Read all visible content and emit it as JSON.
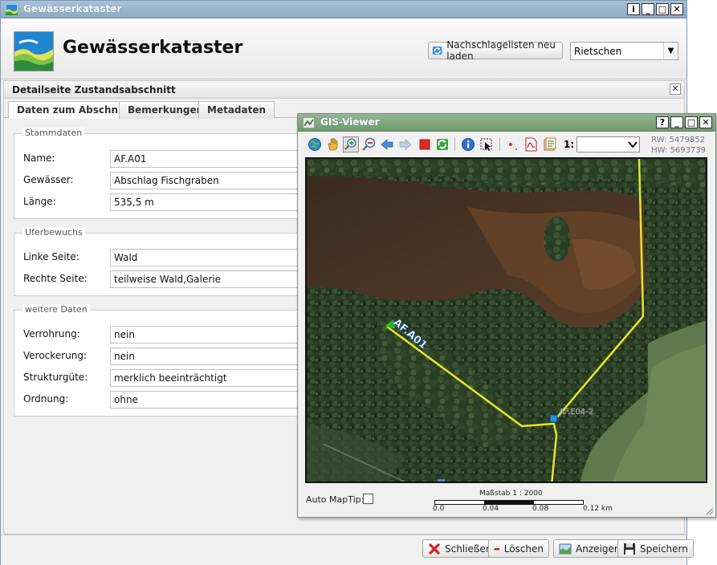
{
  "app": {
    "window_title": "Gewässerkataster",
    "title": "Gewässerkataster",
    "window_buttons": [
      "i",
      "_",
      "□",
      "✕"
    ],
    "reload_button": "Nachschlagelisten neu laden",
    "district": "Rietschen"
  },
  "panel": {
    "title": "Detailseite Zustandsabschnitt",
    "close_label": "✕",
    "tabs": [
      "Daten zum Abschnitt",
      "Bemerkungen",
      "Metadaten"
    ],
    "active_tab": 0
  },
  "stammdaten": {
    "legend": "Stammdaten",
    "fields": [
      {
        "label": "Name:",
        "value": "AF.A01"
      },
      {
        "label": "Gewässer:",
        "value": "Abschlag Fischgraben"
      },
      {
        "label": "Länge:",
        "value": "535,5 m"
      }
    ]
  },
  "uferbewuchs": {
    "legend": "Uferbewuchs",
    "fields": [
      {
        "label": "Linke Seite:",
        "value": "Wald"
      },
      {
        "label": "Rechte Seite:",
        "value": "teilweise Wald,Galerie"
      }
    ]
  },
  "weitere": {
    "legend": "weitere Daten",
    "fields": [
      {
        "label": "Verrohrung:",
        "value": "nein"
      },
      {
        "label": "Verockerung:",
        "value": "nein"
      },
      {
        "label": "Strukturgüte:",
        "value": "merklich beeinträchtigt"
      },
      {
        "label": "Ordnung:",
        "value": "ohne"
      }
    ]
  },
  "footer": {
    "close": "Schließen",
    "delete": "Löschen",
    "show": "Anzeigen",
    "save": "Speichern"
  },
  "gis": {
    "window_title": "GIS-Viewer",
    "window_buttons": [
      "?",
      "_",
      "□",
      "✕"
    ],
    "scale_prefix": "1:",
    "scale_value": "",
    "coords": {
      "rw": "RW: 5479852",
      "hw": "HW: 5693739"
    },
    "map_labels": {
      "segment": "AF.A01",
      "node": "AF.E04-2"
    },
    "maptip_label": "Auto MapTip:",
    "scalebar_title": "Maßstab 1 : 2000",
    "scalebar_ticks": [
      "0.0",
      "0.04",
      "0.08",
      "0.12 km"
    ],
    "tools": [
      "globe-icon",
      "pan-hand-icon",
      "zoom-in-icon",
      "zoom-out-icon",
      "back-arrow-icon",
      "forward-arrow-icon",
      "stop-icon",
      "refresh-icon",
      "info-icon",
      "select-icon",
      "point-icon",
      "pdf-icon",
      "print-icon"
    ]
  },
  "colors": {
    "title_bar": "#8ea9c4",
    "gis_title_bar": "#6f9a6f",
    "stream_line": "#e6e62a",
    "node": "#2f8de0",
    "segment_start": "#27b327"
  }
}
